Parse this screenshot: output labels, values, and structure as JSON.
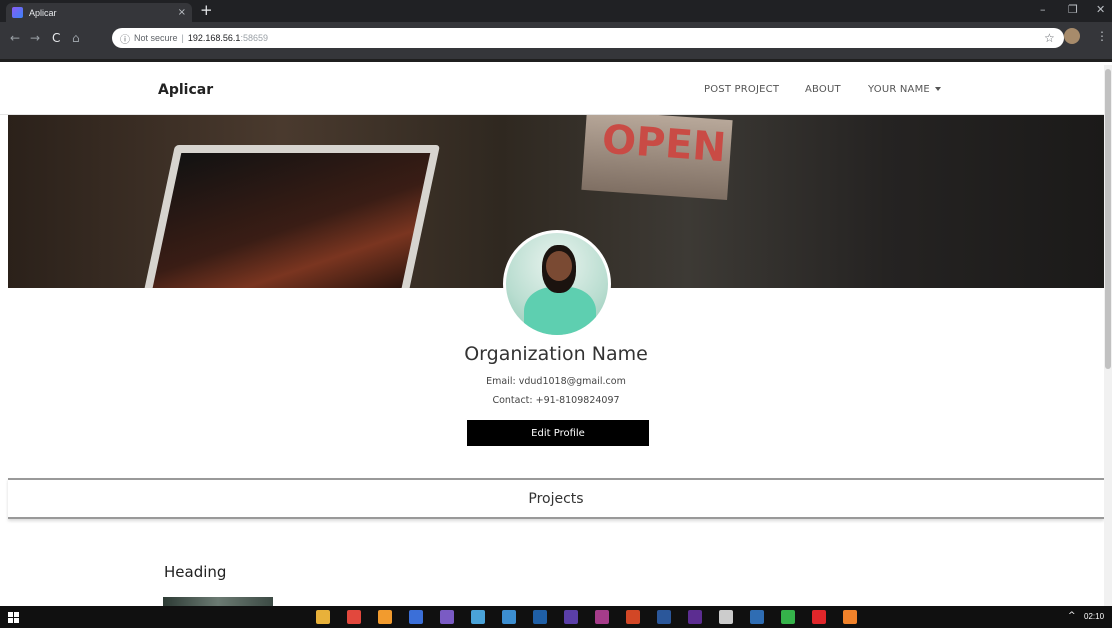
{
  "browser": {
    "tab_title": "Aplicar",
    "tab_close": "×",
    "new_tab": "+",
    "minimize": "–",
    "restore": "❐",
    "close": "✕",
    "back": "←",
    "forward": "→",
    "reload": "C",
    "home": "⌂",
    "security_label": "Not secure",
    "separator": "|",
    "url_host": "192.168.56.1",
    "url_port": ":58659",
    "bookmark": "☆",
    "menu": "⋮"
  },
  "navbar": {
    "brand": "Aplicar",
    "links": [
      "POST PROJECT",
      "ABOUT",
      "YOUR NAME"
    ]
  },
  "profile": {
    "org_name": "Organization Name",
    "email": "Email: vdud1018@gmail.com",
    "contact": "Contact: +91-8109824097",
    "edit_button": "Edit Profile"
  },
  "cover": {
    "sign_text": "OPEN"
  },
  "projects": {
    "section_title": "Projects",
    "first_card_heading": "Heading"
  },
  "taskbar": {
    "clock": "02:10",
    "tray_chevron": "^",
    "apps": [
      {
        "name": "file-explorer-icon",
        "color": "#e8b13a"
      },
      {
        "name": "chrome-icon",
        "color": "#e2483d"
      },
      {
        "name": "sublime-icon",
        "color": "#f29b2e"
      },
      {
        "name": "app-icon",
        "color": "#3b6fd8"
      },
      {
        "name": "photo-icon",
        "color": "#7a5bc4"
      },
      {
        "name": "media-icon",
        "color": "#4aa3d8"
      },
      {
        "name": "image-icon",
        "color": "#3c8ed0"
      },
      {
        "name": "photoshop-icon",
        "color": "#1f5fa6"
      },
      {
        "name": "premiere-icon",
        "color": "#5b3fa8"
      },
      {
        "name": "xd-icon",
        "color": "#a63c8a"
      },
      {
        "name": "powerpoint-icon",
        "color": "#d24726"
      },
      {
        "name": "word-icon",
        "color": "#2b579a"
      },
      {
        "name": "visualstudio-icon",
        "color": "#5c2d91"
      },
      {
        "name": "settings-icon",
        "color": "#cccccc"
      },
      {
        "name": "photos-icon",
        "color": "#2f6db3"
      },
      {
        "name": "whatsapp-icon",
        "color": "#35b34a"
      },
      {
        "name": "opera-icon",
        "color": "#e0262a"
      },
      {
        "name": "firefox-icon",
        "color": "#f1822a"
      }
    ]
  }
}
